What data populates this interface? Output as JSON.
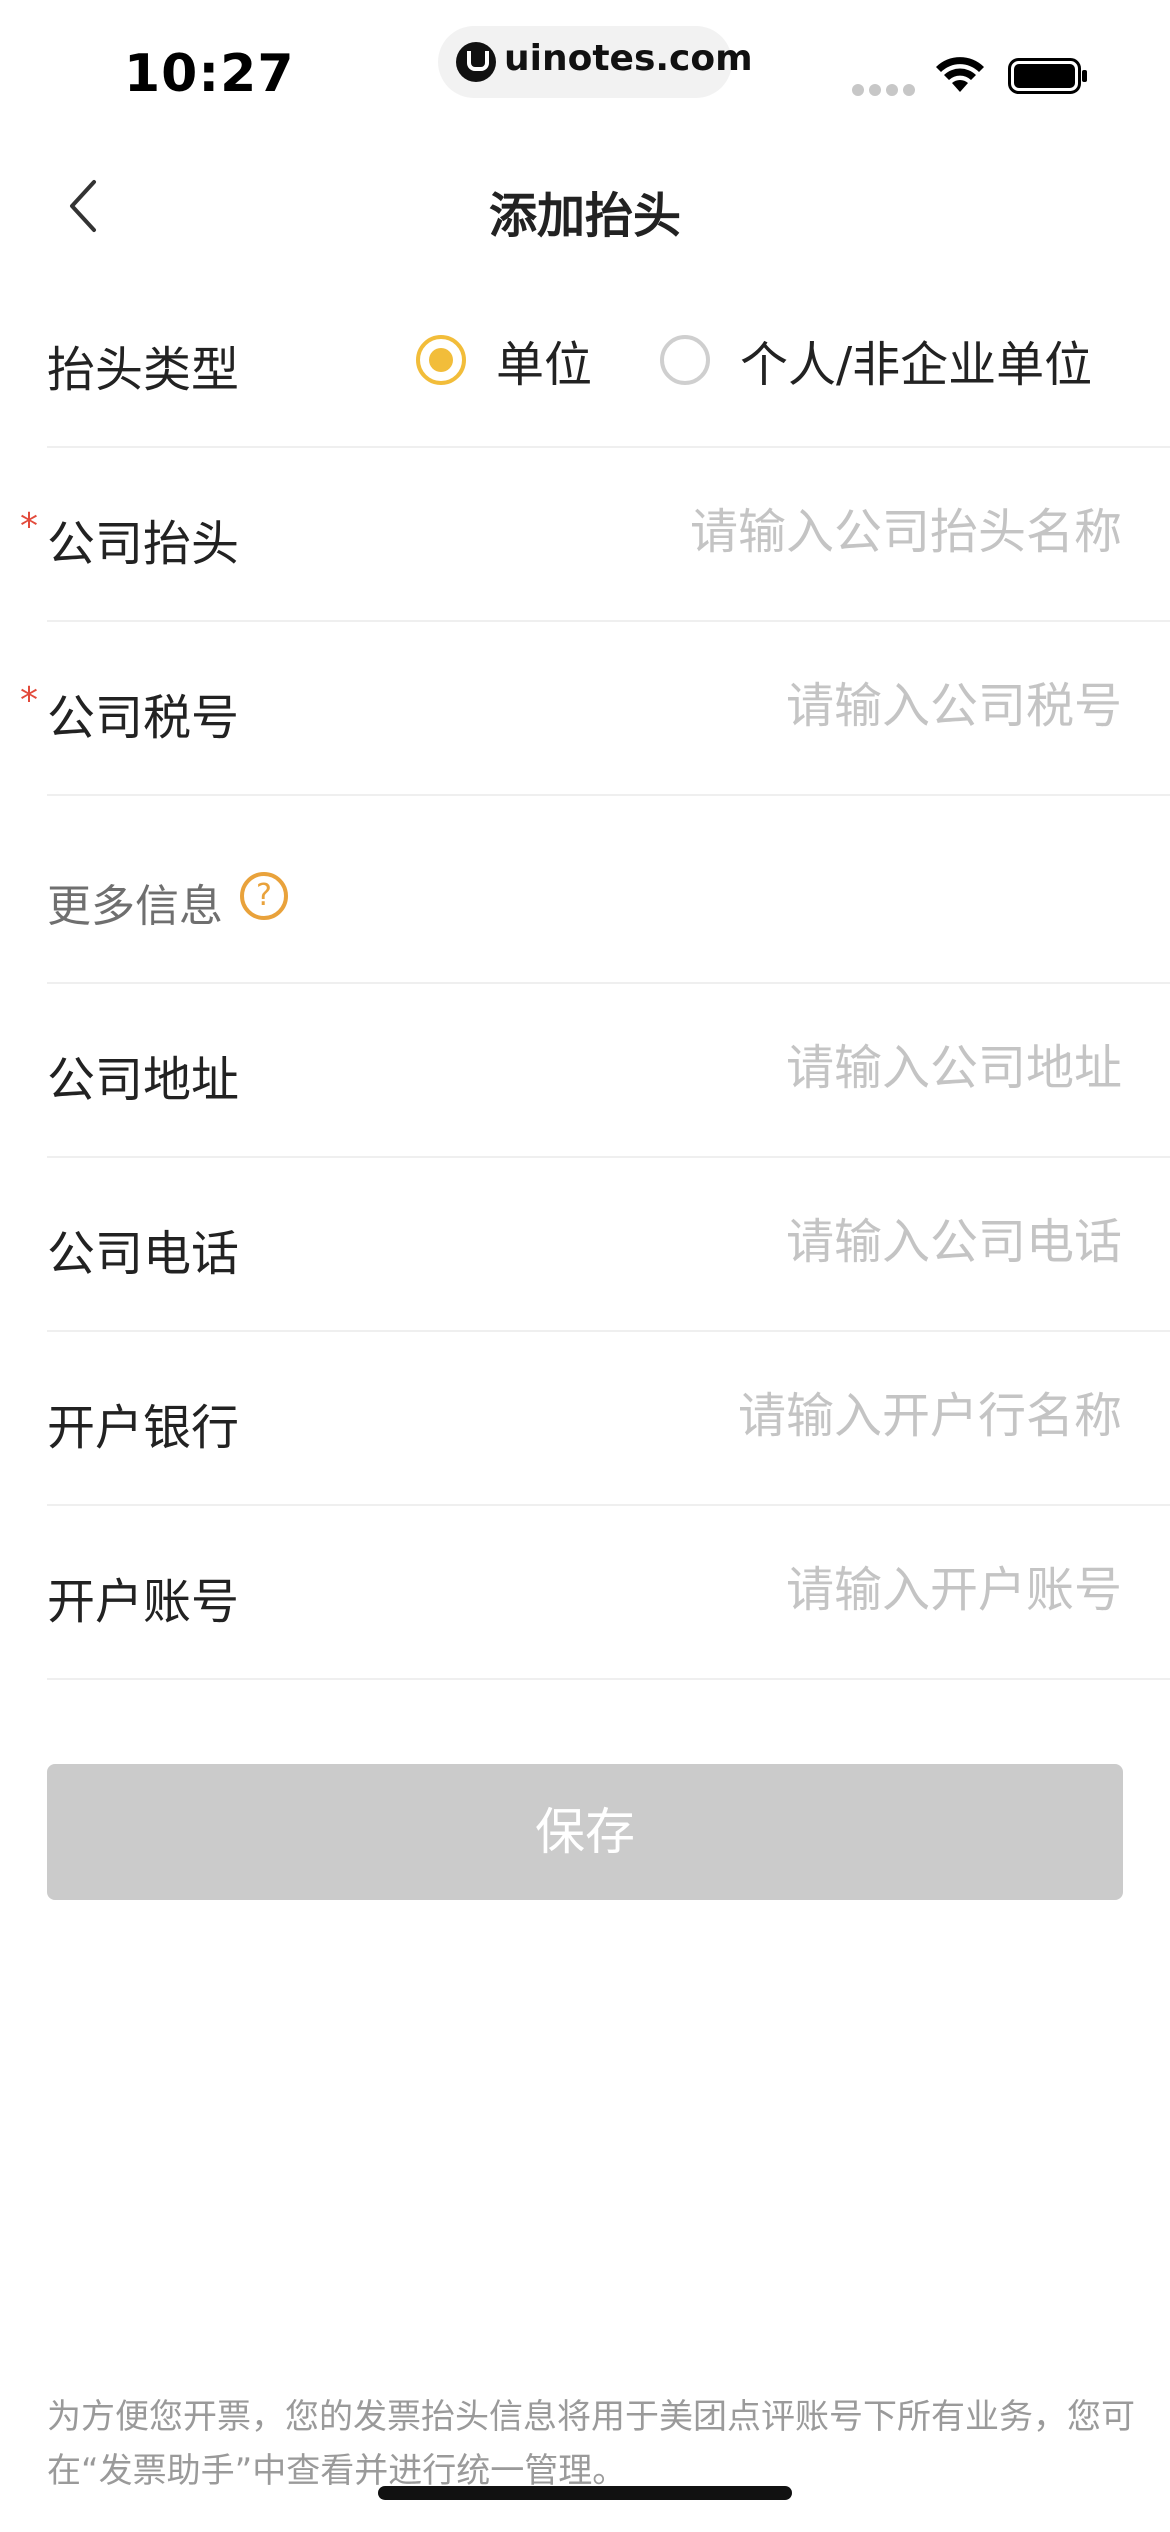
{
  "status_bar": {
    "time": "10:27",
    "url": "uinotes.com"
  },
  "nav": {
    "title": "添加抬头"
  },
  "header_type": {
    "label": "抬头类型",
    "options": [
      {
        "label": "单位",
        "checked": true
      },
      {
        "label": "个人/非企业单位",
        "checked": false
      }
    ]
  },
  "fields": {
    "company_title": {
      "label": "公司抬头",
      "placeholder": "请输入公司抬头名称",
      "value": "",
      "required": "*"
    },
    "company_tax_id": {
      "label": "公司税号",
      "placeholder": "请输入公司税号",
      "value": "",
      "required": "*"
    }
  },
  "more_info": {
    "label": "更多信息",
    "help_glyph": "?",
    "fields": {
      "address": {
        "label": "公司地址",
        "placeholder": "请输入公司地址",
        "value": ""
      },
      "phone": {
        "label": "公司电话",
        "placeholder": "请输入公司电话",
        "value": ""
      },
      "bank": {
        "label": "开户银行",
        "placeholder": "请输入开户行名称",
        "value": ""
      },
      "account": {
        "label": "开户账号",
        "placeholder": "请输入开户账号",
        "value": ""
      }
    }
  },
  "save_button": {
    "label": "保存"
  },
  "footer": {
    "note": "为方便您开票，您的发票抬头信息将用于美团点评账号下所有业务，您可在“发票助手”中查看并进行统一管理。"
  },
  "colors": {
    "accent": "#f2bd3a",
    "help_icon": "#e9a23b",
    "required": "#e24a3b",
    "button_disabled": "#cbcbcb"
  }
}
